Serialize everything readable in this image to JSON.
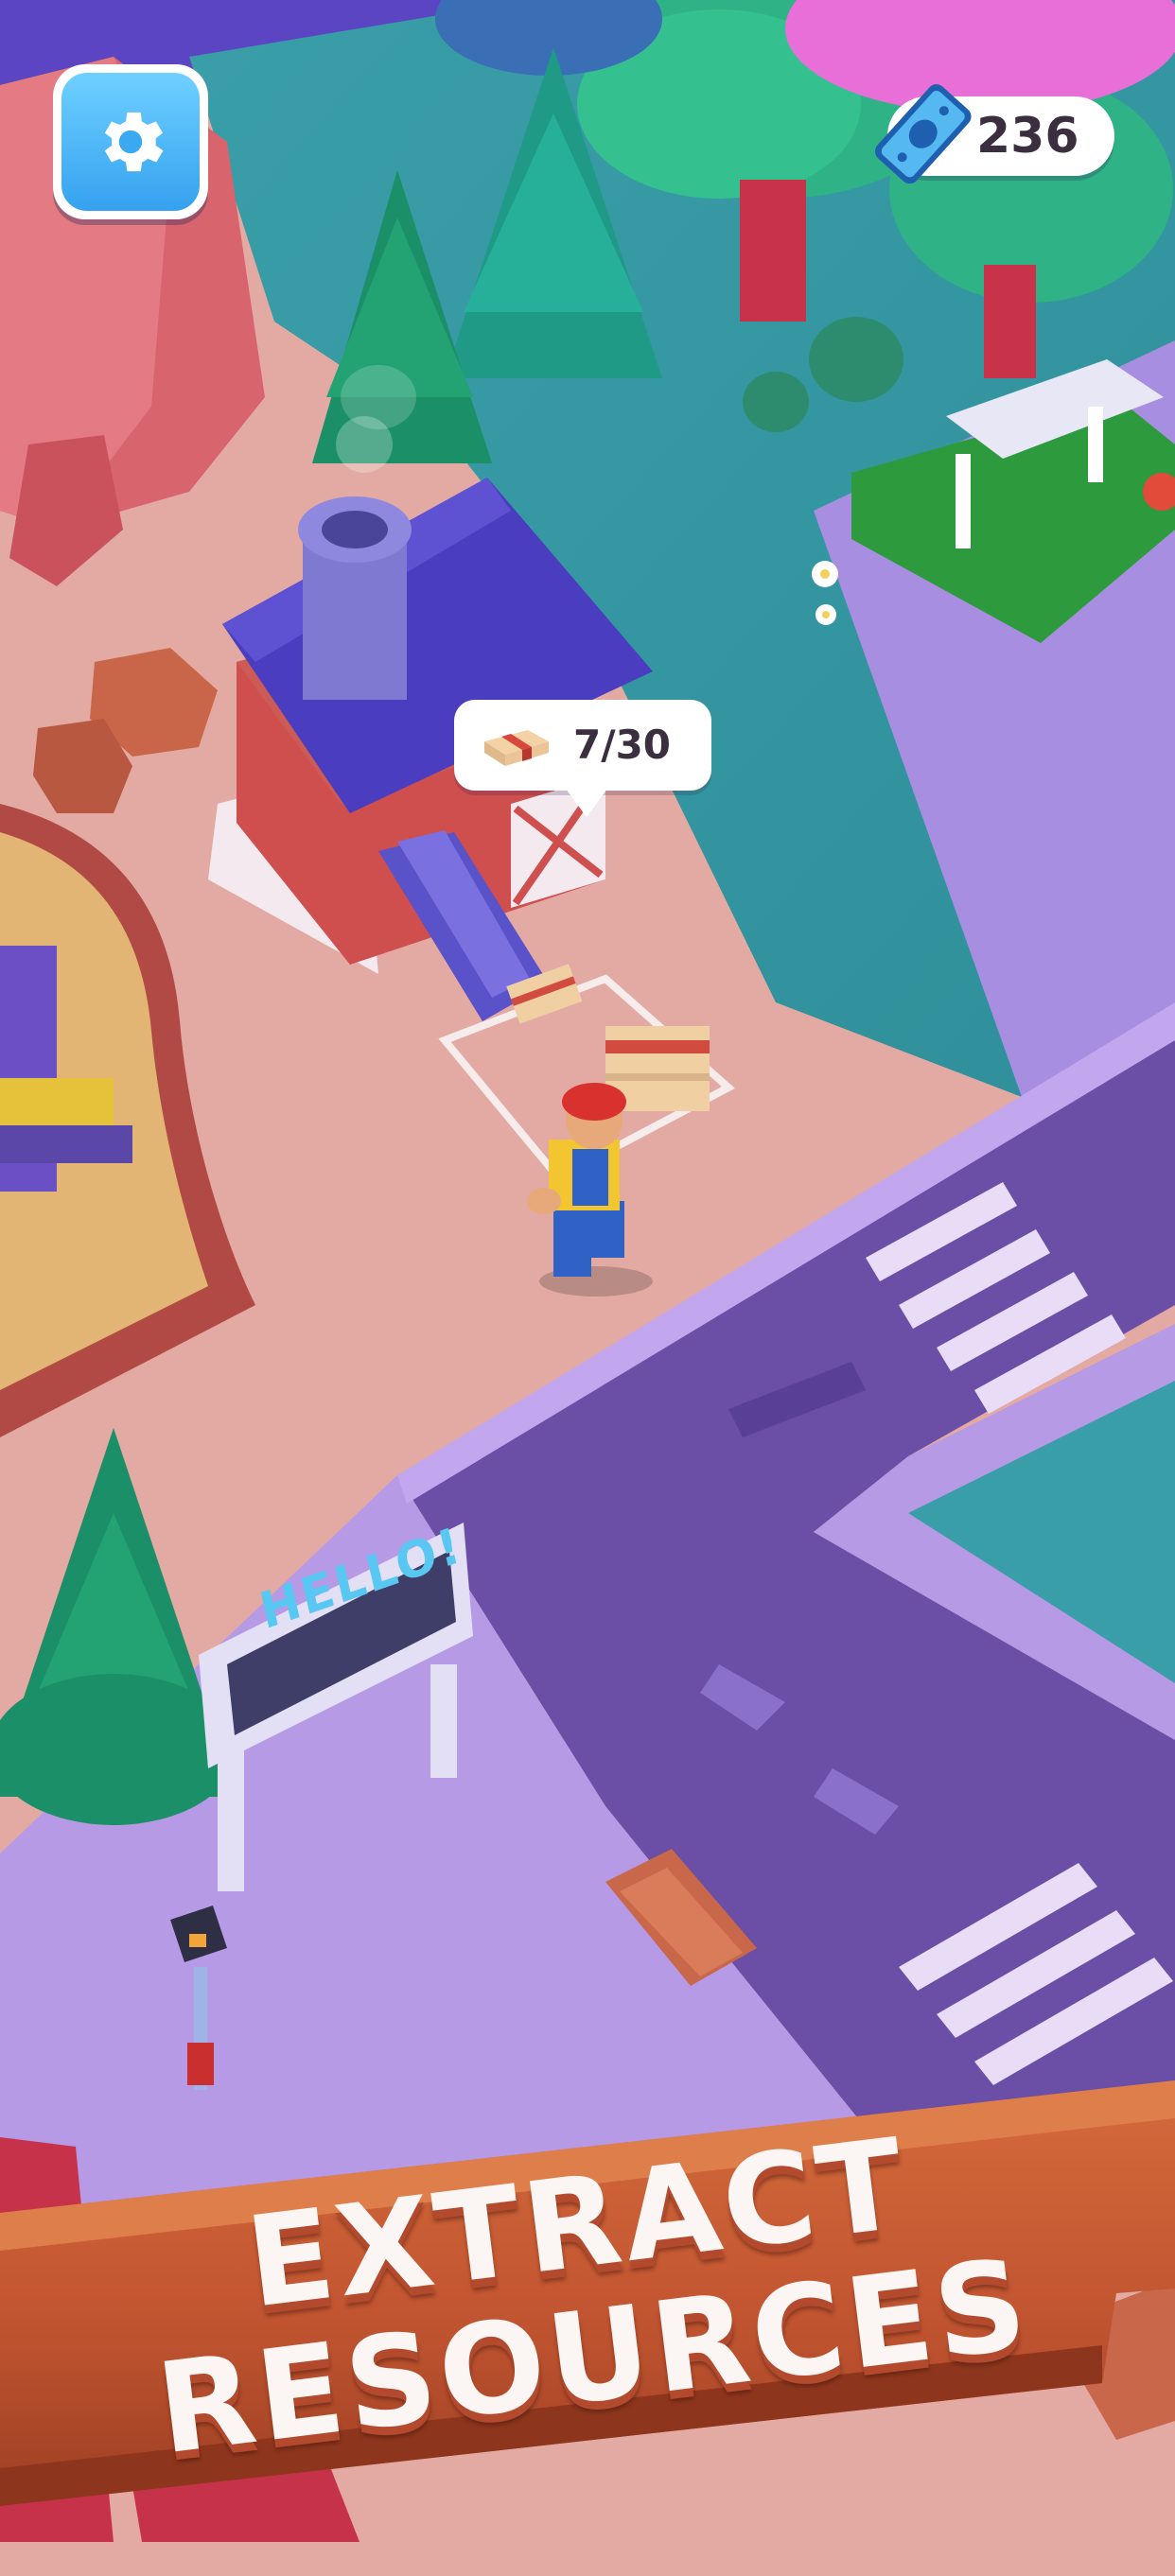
{
  "hud": {
    "settings_icon": "gear-icon",
    "currency_icon": "cash-banknote-icon",
    "currency_amount": "236"
  },
  "production": {
    "resource_icon": "plank-stack-icon",
    "resource_count": "7/30"
  },
  "scene": {
    "sign_text": "HELLO!"
  },
  "banner": {
    "line1": "EXTRACT",
    "line2": "RESOURCES"
  },
  "colors": {
    "ground": "#e2aaa3",
    "grass": "#3aa4a7",
    "road": "#6b4ea6",
    "sidewalk": "#b79ae6",
    "barn_roof": "#4a3dbf",
    "barn_wall": "#cf4e4e",
    "settings_blue": "#35a2f0",
    "banner_wood": "#c65a33"
  }
}
